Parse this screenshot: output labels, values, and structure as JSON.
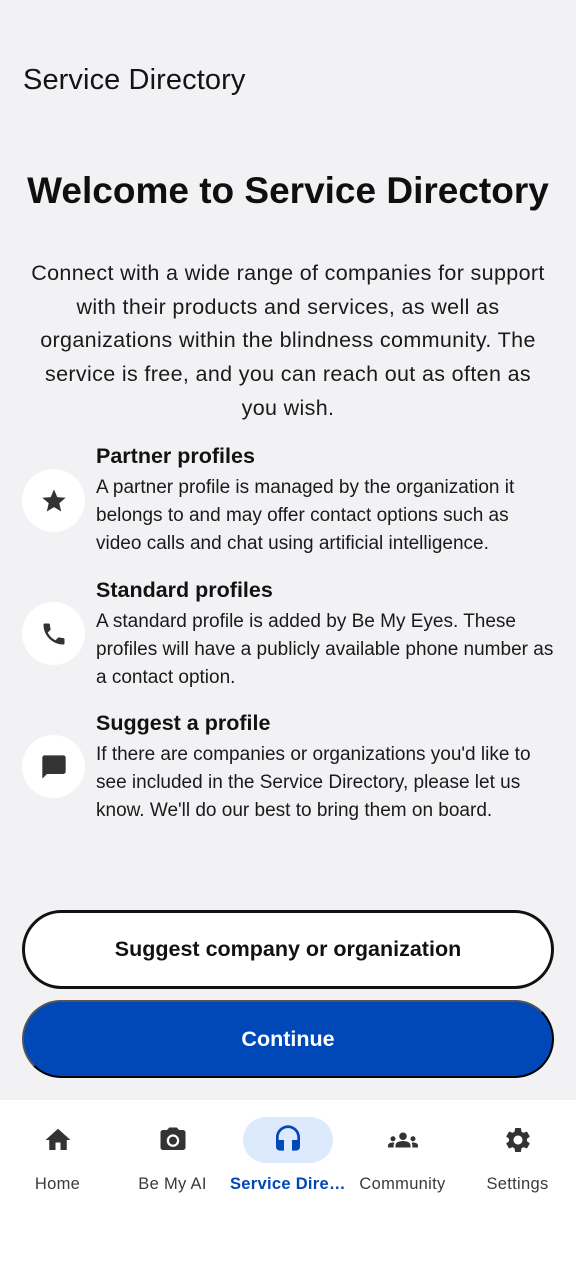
{
  "app_bar": {
    "title": "Service Directory"
  },
  "welcome": {
    "title": "Welcome to Service Directory",
    "intro": "Connect with a wide range of companies for support with their products and services, as well as organizations within the blindness community. The service is free, and you can reach out as often as you wish."
  },
  "features": [
    {
      "icon": "star-icon",
      "title": "Partner profiles",
      "description": "A partner profile is managed by the organization it belongs to and may offer contact options such as video calls and chat using artificial intelligence."
    },
    {
      "icon": "phone-icon",
      "title": "Standard profiles",
      "description": "A standard profile is added by Be My Eyes. These profiles will have a publicly available phone number as a contact option."
    },
    {
      "icon": "chat-icon",
      "title": "Suggest a profile",
      "description": "If there are companies or organizations you'd like to see included in the Service Directory, please let us know. We'll do our best to bring them on board."
    }
  ],
  "buttons": {
    "suggest": "Suggest company or organization",
    "continue": "Continue"
  },
  "nav": {
    "items": [
      {
        "label": "Home",
        "icon": "home-icon",
        "active": false
      },
      {
        "label": "Be My AI",
        "icon": "camera-icon",
        "active": false
      },
      {
        "label": "Service Dire…",
        "icon": "headset-icon",
        "active": true
      },
      {
        "label": "Community",
        "icon": "people-icon",
        "active": false
      },
      {
        "label": "Settings",
        "icon": "gear-icon",
        "active": false
      }
    ]
  },
  "colors": {
    "background": "#f2f2f5",
    "primary": "#0047b8",
    "active_pill": "#dde9fc",
    "nav_background": "#ffffff"
  }
}
